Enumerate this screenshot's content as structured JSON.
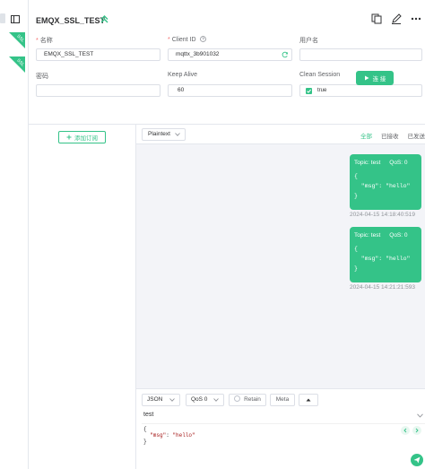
{
  "connection": {
    "title": "EMQX_SSL_TEST",
    "badges": [
      "SSL",
      "SSL"
    ]
  },
  "form": {
    "name_label": "名称",
    "name_value": "EMQX_SSL_TEST",
    "client_id_label": "Client ID",
    "client_id_value": "mqttx_3b901032",
    "username_label": "用户名",
    "username_value": "",
    "password_label": "密码",
    "password_value": "",
    "keepalive_label": "Keep Alive",
    "keepalive_value": "60",
    "clean_session_label": "Clean Session",
    "clean_session_value": "true",
    "connect_label": "连 接"
  },
  "subscriptions": {
    "add_label": "添加订阅"
  },
  "messages": {
    "format": "Plaintext",
    "filters": [
      "全部",
      "已接收",
      "已发送"
    ],
    "items": [
      {
        "topic": "Topic: test",
        "qos": "QoS: 0",
        "payload": "{\n  \"msg\": \"hello\"\n}",
        "time": "2024-04-15 14:18:40:519"
      },
      {
        "topic": "Topic: test",
        "qos": "QoS: 0",
        "payload": "{\n  \"msg\": \"hello\"\n}",
        "time": "2024-04-15 14:21:21:593"
      }
    ]
  },
  "composer": {
    "payload_type": "JSON",
    "qos": "QoS 0",
    "retain_label": "Retain",
    "meta_label": "Meta",
    "topic": "test",
    "payload_line1": "{",
    "payload_key": "\"msg\"",
    "payload_val": "\"hello\"",
    "payload_line3": "}"
  },
  "colors": {
    "accent": "#34c388",
    "danger": "#f56c6c",
    "chat_bg": "#f3f4f8"
  },
  "icons": [
    "panel-toggle-icon",
    "chevron-up-icon",
    "copy-icon",
    "edit-icon",
    "more-icon",
    "help-circle-icon",
    "refresh-icon",
    "play-icon",
    "plus-icon",
    "send-icon"
  ]
}
